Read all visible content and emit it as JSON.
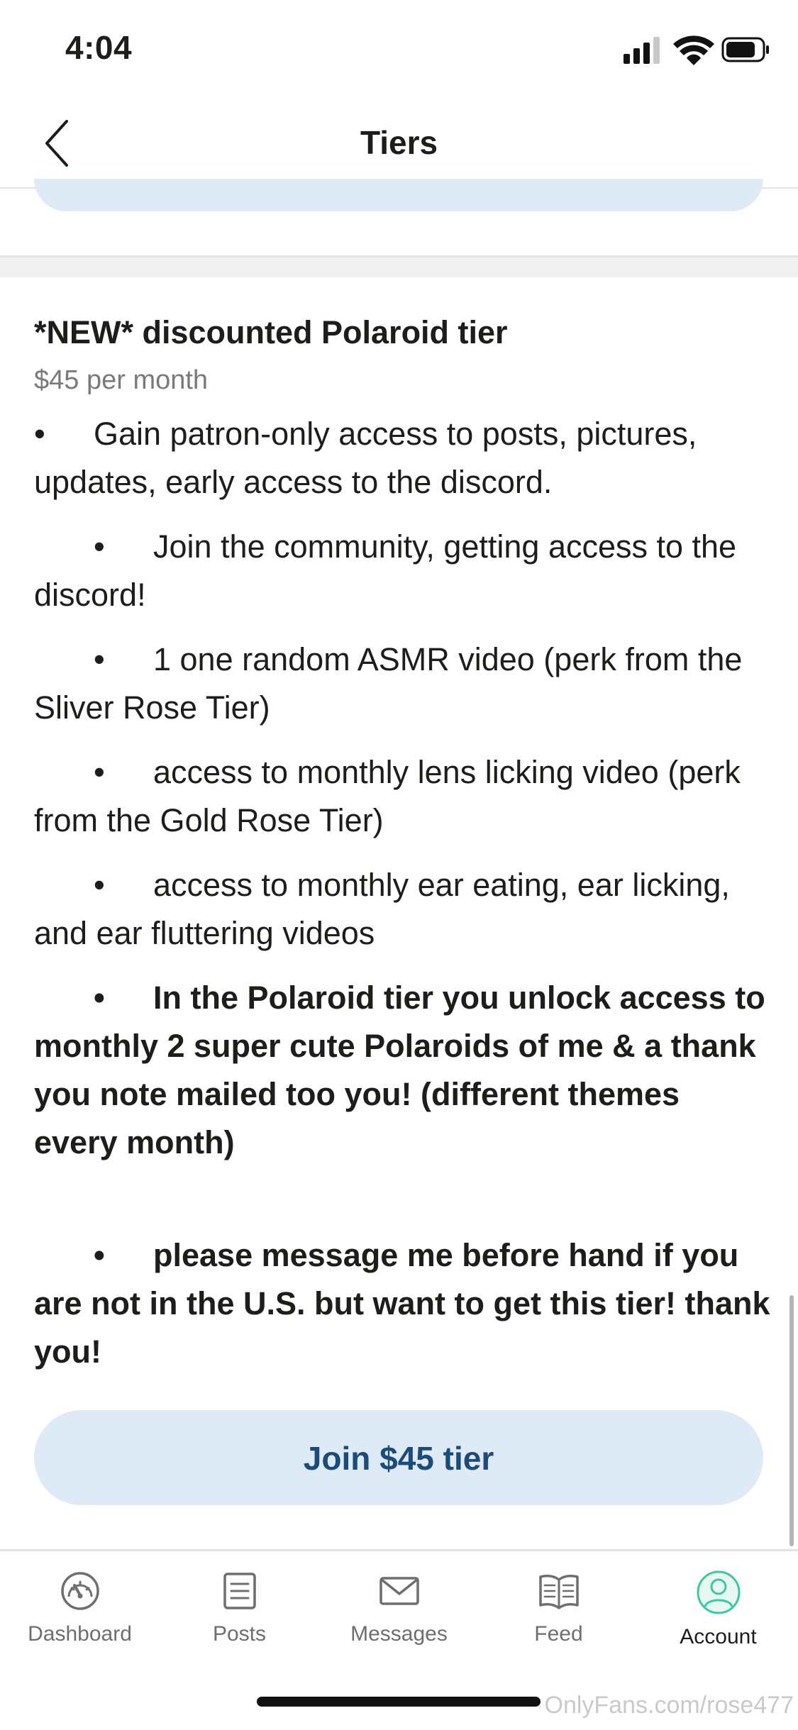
{
  "status_bar": {
    "time": "4:04"
  },
  "nav": {
    "title": "Tiers"
  },
  "tier": {
    "title": "*NEW* discounted Polaroid tier",
    "price": "$45 per month",
    "bullet": "•",
    "benefits": [
      "Gain patron-only access to posts, pictures, updates, early access to the discord.",
      "Join the community, getting access to the discord!",
      "1 one random ASMR video (perk from the Sliver Rose Tier)",
      "access to monthly lens licking video (perk from the Gold Rose Tier)",
      "access to monthly ear eating, ear licking, and ear fluttering videos",
      "In the Polaroid tier you unlock access to monthly 2 super cute Polaroids of me & a thank you note mailed too you! (different themes every month)",
      "please message me before hand if you are not in the U.S. but want to get this tier! thank you!"
    ],
    "join_label": "Join $45 tier"
  },
  "tab_bar": {
    "items": [
      {
        "label": "Dashboard",
        "icon": "dashboard-icon"
      },
      {
        "label": "Posts",
        "icon": "posts-icon"
      },
      {
        "label": "Messages",
        "icon": "messages-icon"
      },
      {
        "label": "Feed",
        "icon": "feed-icon"
      },
      {
        "label": "Account",
        "icon": "account-icon",
        "active": true
      }
    ]
  },
  "watermark": "OnlyFans.com/rose477",
  "colors": {
    "button_bg": "#deeaf6",
    "button_text": "#1b4b7a",
    "account_accent": "#3ec7a3"
  }
}
